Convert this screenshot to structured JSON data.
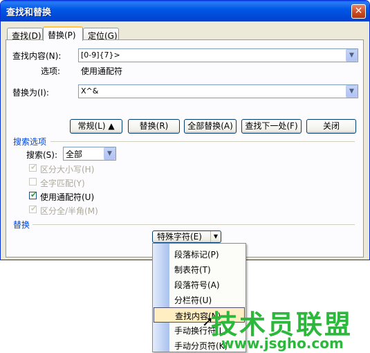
{
  "window": {
    "title": "查找和替换",
    "close_glyph": "✕"
  },
  "tabs": [
    {
      "label": "查找(D)",
      "active": false
    },
    {
      "label": "替换(P)",
      "active": true
    },
    {
      "label": "定位(G)",
      "active": false
    }
  ],
  "find": {
    "label": "查找内容(N):",
    "value": "[0-9]{7}>",
    "options_label": "选项:",
    "options_value": "使用通配符"
  },
  "replace": {
    "label": "替换为(I):",
    "value": "X^&"
  },
  "buttons": {
    "normal": "常规(L) ▲",
    "replace": "替换(R)",
    "replace_all": "全部替换(A)",
    "find_next": "查找下一处(F)",
    "close": "关闭"
  },
  "search_options": {
    "title": "搜索选项",
    "search_label": "搜索(S):",
    "search_value": "全部",
    "checkboxes": [
      {
        "label": "区分大小写(H)",
        "checked": true,
        "disabled": true
      },
      {
        "label": "全字匹配(Y)",
        "checked": false,
        "disabled": true
      },
      {
        "label": "使用通配符(U)",
        "checked": true,
        "disabled": false
      },
      {
        "label": "区分全/半角(M)",
        "checked": true,
        "disabled": true
      }
    ]
  },
  "replace_section": {
    "title": "替换",
    "special_button": "特殊字符(E)"
  },
  "special_menu": {
    "items": [
      "段落标记(P)",
      "制表符(T)",
      "段落符号(A)",
      "分栏符(U)",
      "查找内容(N)",
      "手动换行符(L)",
      "手动分页符(K)"
    ],
    "highlighted_index": 4
  },
  "watermark": {
    "text": "技术员联盟",
    "url": "www.jsgho.com"
  },
  "colors": {
    "title_bar": "#0058e6",
    "dialog_bg": "#ece9d8",
    "section_title": "#0046d5",
    "watermark": "#2db83d",
    "menu_highlight": "#ffeec2"
  }
}
